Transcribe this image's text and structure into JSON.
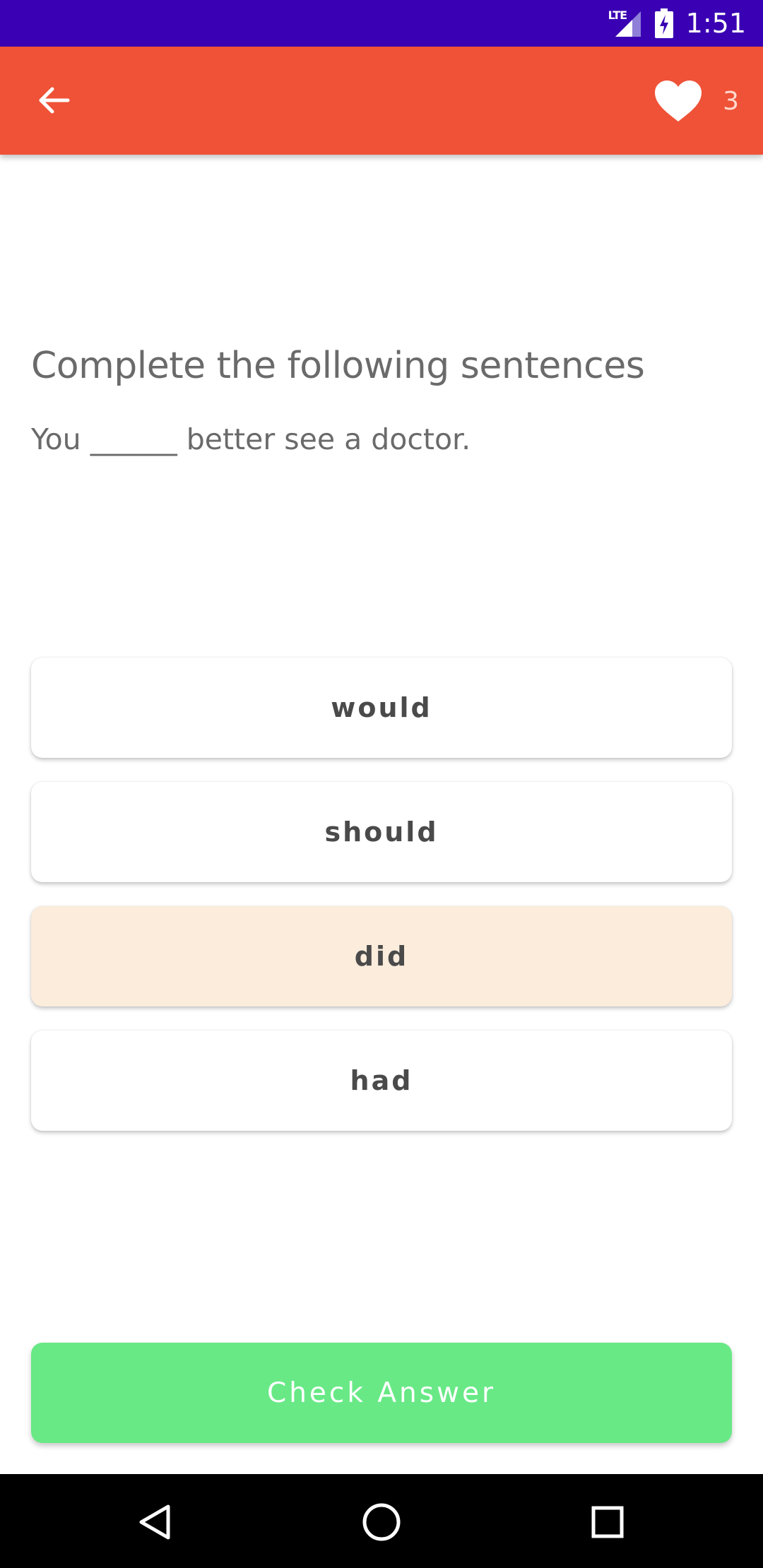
{
  "status_bar": {
    "network": "LTE",
    "time": "1:51"
  },
  "app_bar": {
    "back_icon": "arrow-back-icon",
    "lives_icon": "heart-icon",
    "lives_count": "3"
  },
  "question": {
    "title": "Complete the following sentences",
    "sentence": "You ______ better see a doctor."
  },
  "options": [
    {
      "label": "would",
      "selected": false
    },
    {
      "label": "should",
      "selected": false
    },
    {
      "label": "did",
      "selected": true
    },
    {
      "label": "had",
      "selected": false
    }
  ],
  "check_button": {
    "label": "Check Answer"
  },
  "nav_bar": {
    "back_icon": "triangle-back-icon",
    "home_icon": "circle-home-icon",
    "recents_icon": "square-recents-icon"
  },
  "colors": {
    "status_bar": "#3a00b3",
    "app_bar": "#ef5237",
    "selected_option": "#fbecdc",
    "check_button": "#68e986",
    "nav_bar": "#000000"
  }
}
